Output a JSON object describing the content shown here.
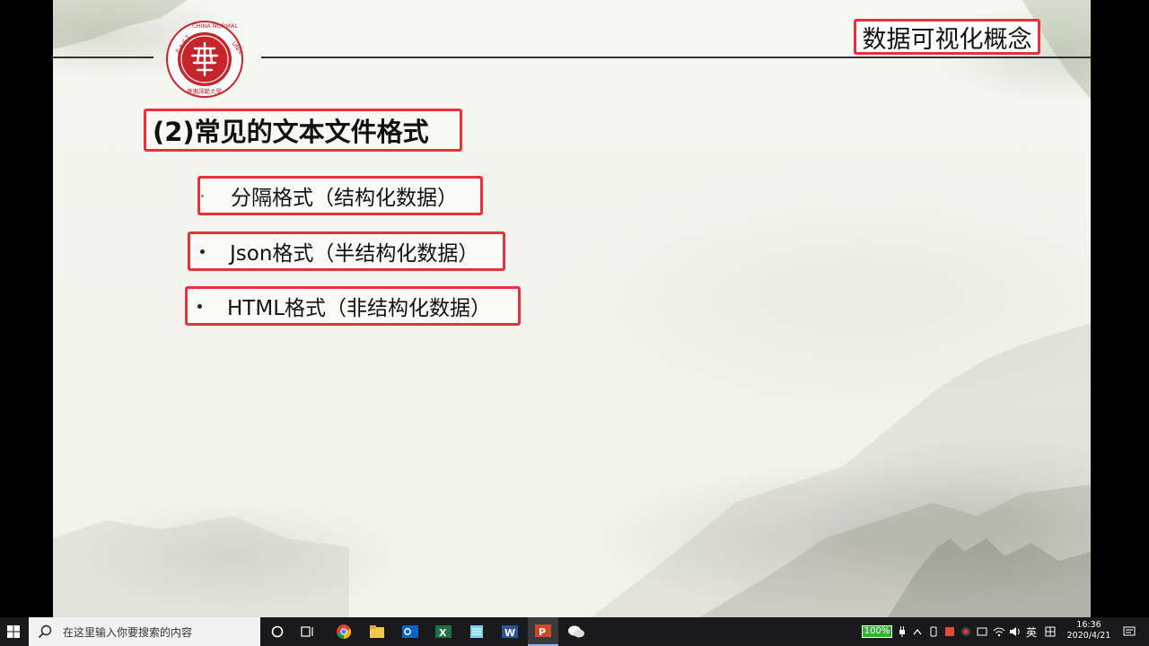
{
  "slide": {
    "title": "数据可视化概念",
    "heading": "(2)常见的文本文件格式",
    "bullets": [
      "分隔格式（结构化数据）",
      "Json格式（半结构化数据）",
      "HTML格式（非结构化数据）"
    ],
    "logo": {
      "name": "east-china-normal-university-logo",
      "text": "EAST CHINA NORMAL UNIVERSITY",
      "accent": "#c8242b"
    },
    "highlight_color": "#e8303a"
  },
  "taskbar": {
    "search_placeholder": "在这里输入你要搜索的内容",
    "apps": [
      "task-view",
      "chrome",
      "file-explorer",
      "outlook",
      "excel",
      "notepad",
      "word",
      "powerpoint",
      "wechat"
    ],
    "active_app": "powerpoint",
    "battery": "100%",
    "ime": "英",
    "time": "16:36",
    "date": "2020/4/21"
  }
}
